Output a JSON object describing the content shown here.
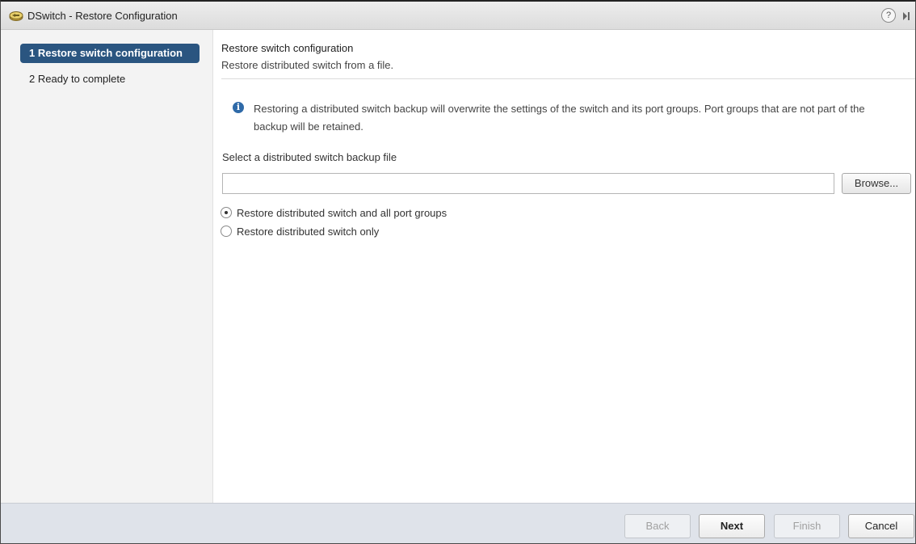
{
  "window": {
    "title": "DSwitch - Restore Configuration",
    "icon": "distributed-switch-icon",
    "help_glyph": "?"
  },
  "steps": [
    {
      "label": "1 Restore switch configuration",
      "active": true
    },
    {
      "label": "2 Ready to complete",
      "active": false
    }
  ],
  "main": {
    "title": "Restore switch configuration",
    "subtitle": "Restore distributed switch from a file.",
    "info_glyph": "i",
    "info_text": "Restoring a distributed switch backup will overwrite the settings of the switch and its port groups. Port groups that are not part of the backup will be retained.",
    "file_label": "Select a distributed switch backup file",
    "file_value": "",
    "browse_label": "Browse...",
    "options": [
      {
        "label": "Restore distributed switch and all port groups",
        "checked": true
      },
      {
        "label": "Restore distributed switch only",
        "checked": false
      }
    ]
  },
  "footer": {
    "back_label": "Back",
    "next_label": "Next",
    "finish_label": "Finish",
    "cancel_label": "Cancel"
  },
  "colors": {
    "active_step_bg": "#2a5580",
    "info_icon": "#2f6aa8",
    "footer_bg": "#dfe3ea"
  }
}
